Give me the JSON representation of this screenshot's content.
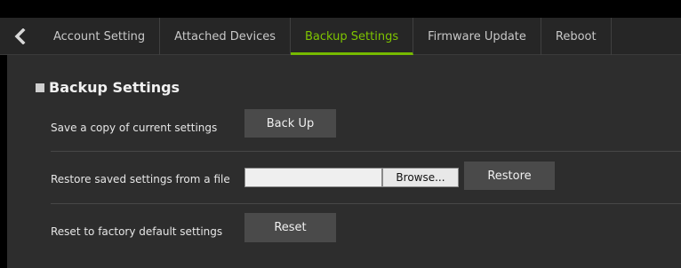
{
  "tabs": [
    {
      "label": "Account Setting",
      "active": false
    },
    {
      "label": "Attached Devices",
      "active": false
    },
    {
      "label": "Backup Settings",
      "active": true
    },
    {
      "label": "Firmware Update",
      "active": false
    },
    {
      "label": "Reboot",
      "active": false
    }
  ],
  "section": {
    "title": "Backup Settings"
  },
  "rows": {
    "backup": {
      "label": "Save a copy of current settings",
      "button": "Back Up"
    },
    "restore": {
      "label": "Restore saved settings from a file",
      "file_value": "",
      "browse_label": "Browse...",
      "button": "Restore"
    },
    "reset": {
      "label": "Reset to factory default settings",
      "button": "Reset"
    }
  },
  "colors": {
    "accent": "#76b900",
    "background": "#2d2d2d",
    "tabbar": "#262626"
  },
  "icons": {
    "back": "chevron-left-icon"
  }
}
